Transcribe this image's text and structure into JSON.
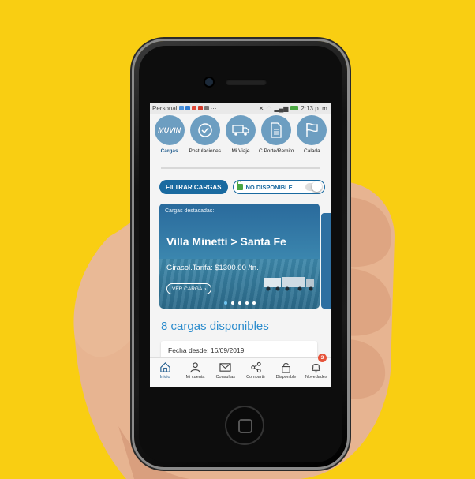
{
  "statusbar": {
    "carrier": "Personal",
    "time": "2:13 p. m."
  },
  "nav": [
    {
      "label": "Cargas",
      "icon": "muvin-logo-icon",
      "active": true
    },
    {
      "label": "Postulaciones",
      "icon": "check-circle-icon",
      "active": false
    },
    {
      "label": "Mi Viaje",
      "icon": "truck-icon",
      "active": false
    },
    {
      "label": "C.Porte/Remito",
      "icon": "document-icon",
      "active": false
    },
    {
      "label": "Calada",
      "icon": "flag-icon",
      "active": false
    }
  ],
  "logo_text": "MUVIN",
  "filters": {
    "filter_button": "FILTRAR CARGAS",
    "toggle_label": "NO DISPONIBLE"
  },
  "banner": {
    "caption": "Cargas destacadas:",
    "route": "Villa Minetti > Santa Fe",
    "detail": "Girasol.Tarifa: $1300.00 /tn.",
    "cta": "VER CARGA",
    "active_slide": 1,
    "slides": 5
  },
  "loads_count": "8 cargas disponibles",
  "card": {
    "date": "Fecha desde: 16/09/2019"
  },
  "tabs": [
    {
      "label": "Inicio",
      "icon": "home-icon",
      "active": true
    },
    {
      "label": "Mi cuenta",
      "icon": "user-icon",
      "active": false
    },
    {
      "label": "Consultas",
      "icon": "envelope-icon",
      "active": false
    },
    {
      "label": "Compartir",
      "icon": "share-icon",
      "active": false
    },
    {
      "label": "Disponible",
      "icon": "lock-icon",
      "active": false
    },
    {
      "label": "Novedades",
      "icon": "bell-icon",
      "active": false,
      "badge": "3"
    }
  ],
  "colors": {
    "background": "#F9CE12",
    "primary": "#1a6aa0",
    "accent": "#2b8ccd",
    "nav_circle": "#6d9ec1",
    "badge": "#e6533a"
  }
}
